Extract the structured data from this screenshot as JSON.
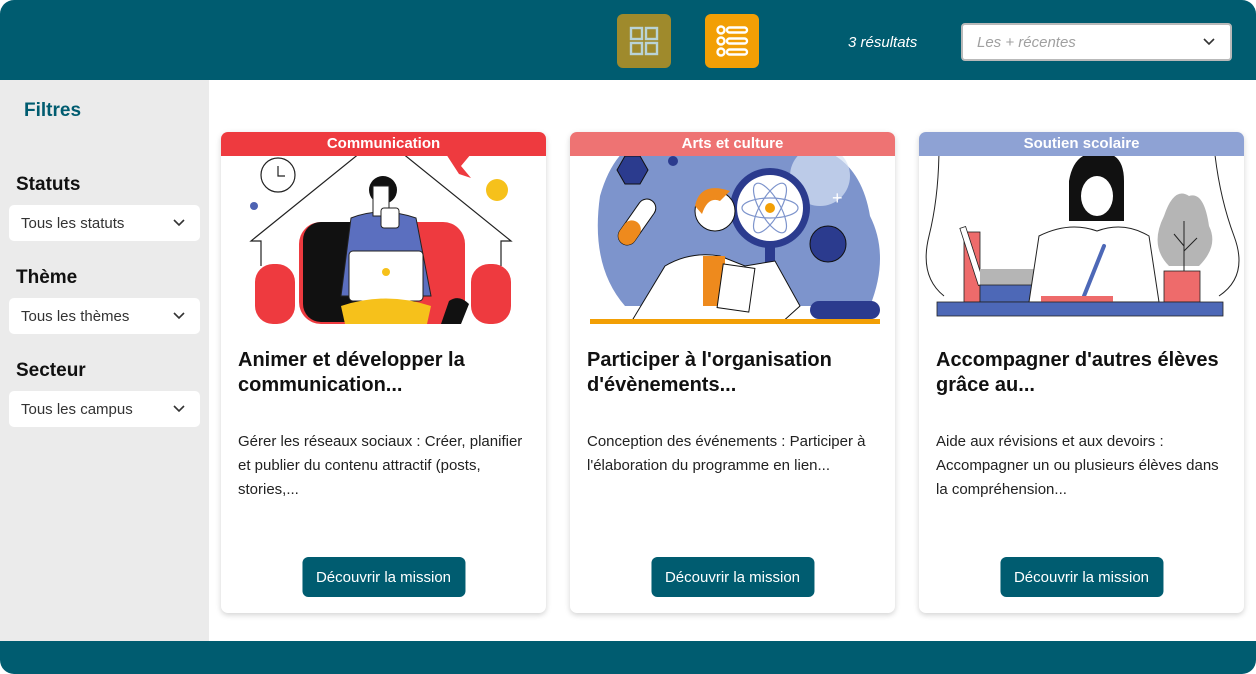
{
  "header": {
    "view_grid_icon": "grid-view-icon",
    "view_list_icon": "list-view-icon",
    "results_count": "3 résultats",
    "sort": {
      "placeholder": "Les + récentes",
      "selected": ""
    }
  },
  "sidebar": {
    "title": "Filtres",
    "filters": [
      {
        "label": "Statuts",
        "value": "Tous les statuts"
      },
      {
        "label": "Thème",
        "value": "Tous les thèmes"
      },
      {
        "label": "Secteur",
        "value": "Tous les campus"
      }
    ]
  },
  "cards": [
    {
      "category": "Communication",
      "category_color": "#ee3a3f",
      "title": "Animer et développer la communication...",
      "description": "Gérer les réseaux sociaux : Créer, planifier et publier du contenu attractif (posts, stories,...",
      "button": "Découvrir la mission"
    },
    {
      "category": "Arts et culture",
      "category_color": "#ee7373",
      "title": "Participer à l'organisation d'évènements...",
      "description": "Conception des événements : Participer à l'élaboration du programme en lien...",
      "button": "Découvrir la mission"
    },
    {
      "category": "Soutien scolaire",
      "category_color": "#8ea2d4",
      "title": "Accompagner d'autres élèves grâce au...",
      "description": "Aide aux révisions et aux devoirs : Accompagner un ou plusieurs élèves dans la compréhension...",
      "button": "Découvrir la mission"
    }
  ],
  "colors": {
    "brand": "#005c70",
    "grid_button": "#9f8a2c",
    "list_button": "#f29f05",
    "sidebar_bg": "#ebebeb"
  }
}
